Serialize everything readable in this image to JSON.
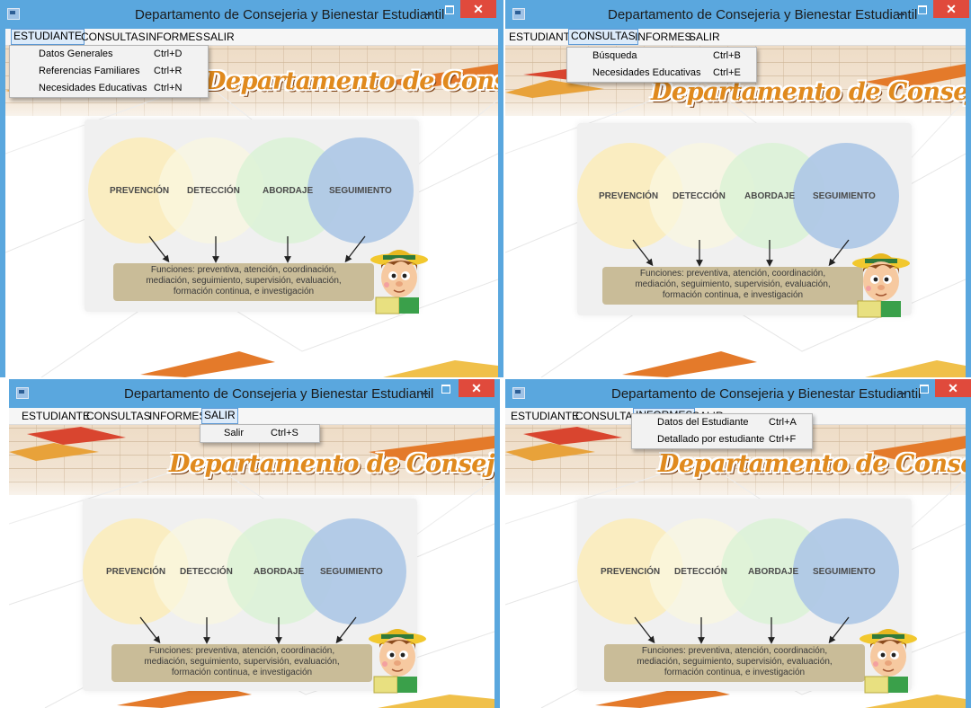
{
  "window_title": "Departamento de Consejeria y Bienestar Estudiantil",
  "close_glyph": "✕",
  "menu": [
    "ESTUDIANTE",
    "CONSULTAS",
    "INFORMES",
    "SALIR"
  ],
  "banner_text": "Departamento de Consejeria y Bienestar Estudiantil",
  "circles": [
    "PREVENCIÓN",
    "DETECCIÓN",
    "ABORDAJE",
    "SEGUIMIENTO"
  ],
  "functions_lines": [
    "Funciones: preventiva, atención, coordinación,",
    "mediación,  seguimiento, supervisión,  evaluación,",
    "formación continua, e investigación"
  ],
  "dropdowns": {
    "estudiante": [
      {
        "label": "Datos Generales",
        "shortcut": "Ctrl+D"
      },
      {
        "label": "Referencias Familiares",
        "shortcut": "Ctrl+R"
      },
      {
        "label": "Necesidades Educativas",
        "shortcut": "Ctrl+N"
      }
    ],
    "consultas": [
      {
        "label": "Búsqueda",
        "shortcut": "Ctrl+B"
      },
      {
        "label": "Necesidades Educativas",
        "shortcut": "Ctrl+E"
      }
    ],
    "salir": [
      {
        "label": "Salir",
        "shortcut": "Ctrl+S"
      }
    ],
    "informes": [
      {
        "label": "Datos del Estudiante",
        "shortcut": "Ctrl+A"
      },
      {
        "label": "Detallado por estudiante",
        "shortcut": "Ctrl+F"
      }
    ]
  },
  "colors": {
    "titlebar": "#5aa7de",
    "close_button": "#e04a3c",
    "menu_highlight": "#dcebfa",
    "banner": "#e08a1e",
    "functions_box": "#c9bc98"
  },
  "icons": [
    "app-icon",
    "minimize-icon",
    "maximize-icon",
    "close-icon"
  ]
}
